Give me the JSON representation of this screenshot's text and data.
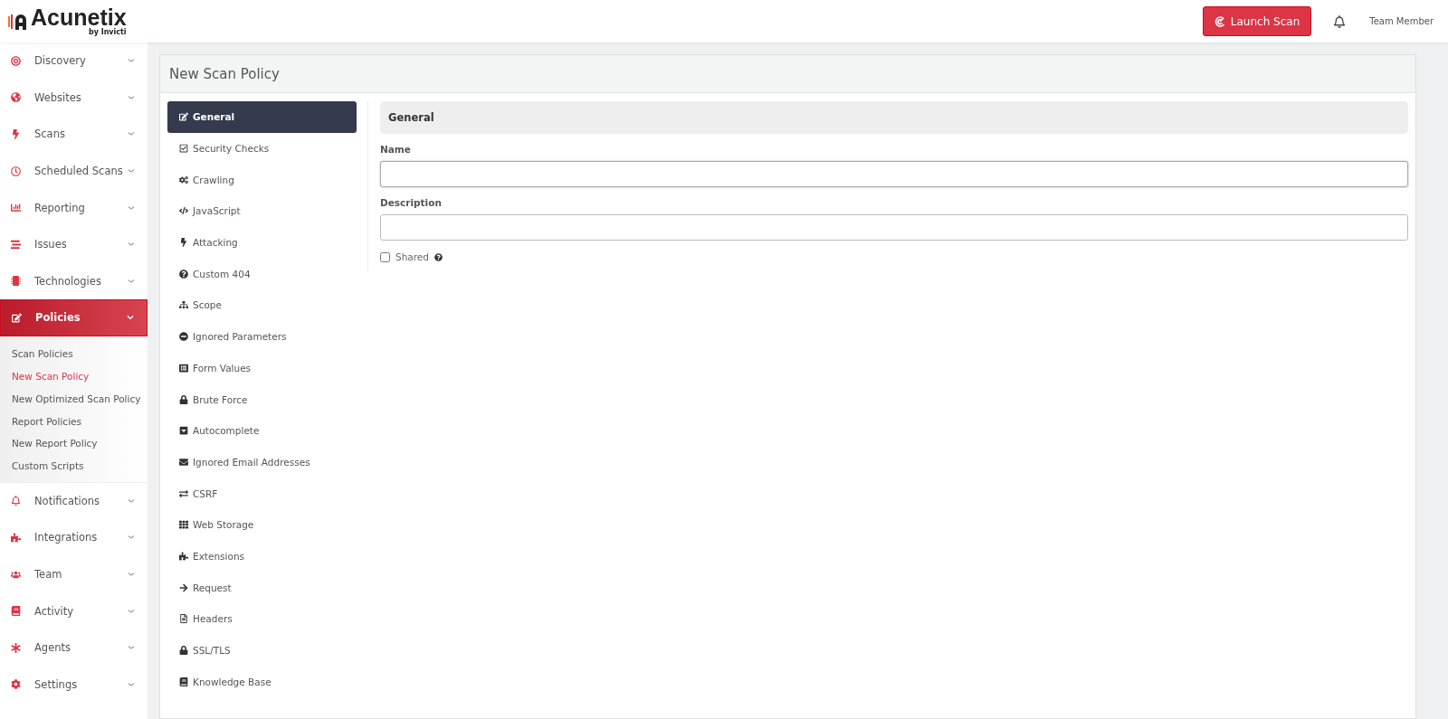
{
  "header": {
    "logo": "Acunetix",
    "logo_sub": "by Invicti",
    "launch_button": "Launch Scan",
    "user": "Team Member"
  },
  "sidebar": {
    "items": [
      {
        "label": "Discovery",
        "selected": false,
        "expanded": false
      },
      {
        "label": "Websites",
        "selected": false,
        "expanded": false
      },
      {
        "label": "Scans",
        "selected": false,
        "expanded": false
      },
      {
        "label": "Scheduled Scans",
        "selected": false,
        "expanded": false
      },
      {
        "label": "Reporting",
        "selected": false,
        "expanded": false
      },
      {
        "label": "Issues",
        "selected": false,
        "expanded": false
      },
      {
        "label": "Technologies",
        "selected": false,
        "expanded": false
      },
      {
        "label": "Policies",
        "selected": true,
        "expanded": true,
        "children": [
          {
            "label": "Scan Policies",
            "selected": false
          },
          {
            "label": "New Scan Policy",
            "selected": true
          },
          {
            "label": "New Optimized Scan Policy",
            "selected": false
          },
          {
            "label": "Report Policies",
            "selected": false
          },
          {
            "label": "New Report Policy",
            "selected": false
          },
          {
            "label": "Custom Scripts",
            "selected": false
          }
        ]
      },
      {
        "label": "Notifications",
        "selected": false,
        "expanded": false
      },
      {
        "label": "Integrations",
        "selected": false,
        "expanded": false
      },
      {
        "label": "Team",
        "selected": false,
        "expanded": false
      },
      {
        "label": "Activity",
        "selected": false,
        "expanded": false
      },
      {
        "label": "Agents",
        "selected": false,
        "expanded": false
      },
      {
        "label": "Settings",
        "selected": false,
        "expanded": false
      }
    ]
  },
  "page": {
    "title": "New Scan Policy",
    "sections": [
      {
        "label": "General",
        "selected": true
      },
      {
        "label": "Security Checks",
        "selected": false
      },
      {
        "label": "Crawling",
        "selected": false
      },
      {
        "label": "JavaScript",
        "selected": false
      },
      {
        "label": "Attacking",
        "selected": false
      },
      {
        "label": "Custom 404",
        "selected": false
      },
      {
        "label": "Scope",
        "selected": false
      },
      {
        "label": "Ignored Parameters",
        "selected": false
      },
      {
        "label": "Form Values",
        "selected": false
      },
      {
        "label": "Brute Force",
        "selected": false
      },
      {
        "label": "Autocomplete",
        "selected": false
      },
      {
        "label": "Ignored Email Addresses",
        "selected": false
      },
      {
        "label": "CSRF",
        "selected": false
      },
      {
        "label": "Web Storage",
        "selected": false
      },
      {
        "label": "Extensions",
        "selected": false
      },
      {
        "label": "Request",
        "selected": false
      },
      {
        "label": "Headers",
        "selected": false
      },
      {
        "label": "SSL/TLS",
        "selected": false
      },
      {
        "label": "Knowledge Base",
        "selected": false
      }
    ],
    "form": {
      "heading": "General",
      "name_label": "Name",
      "description_label": "Description",
      "shared_label": "Shared",
      "shared_checked": false
    }
  }
}
